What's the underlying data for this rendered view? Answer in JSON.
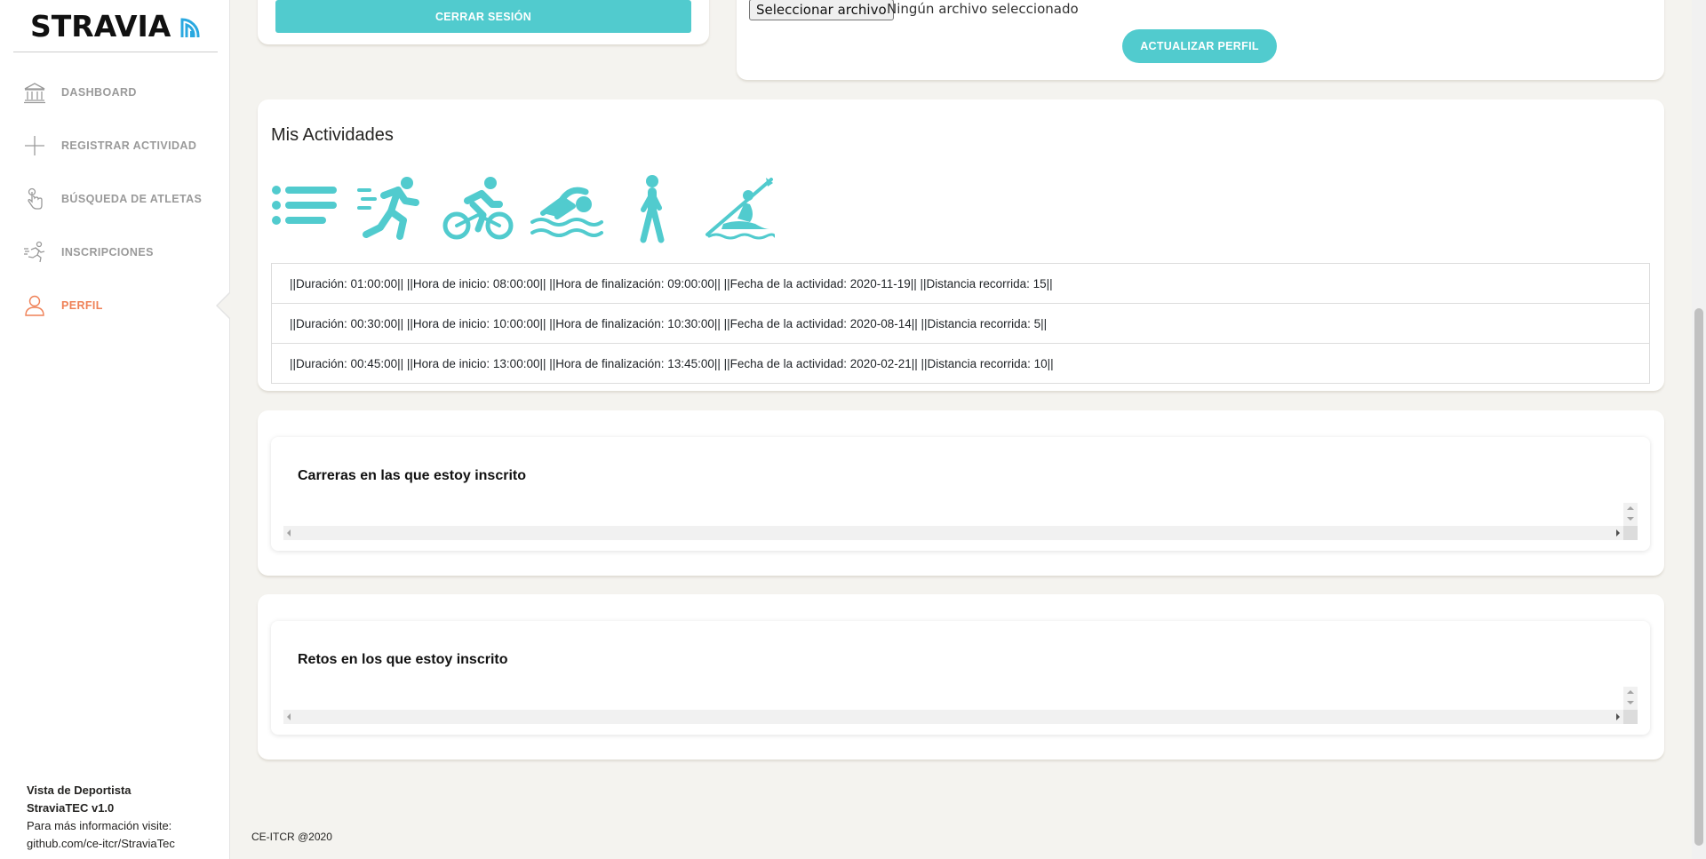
{
  "brand": {
    "name": "STRAVIA"
  },
  "sidebar": {
    "items": [
      {
        "label": "DASHBOARD",
        "icon": "bank-icon"
      },
      {
        "label": "REGISTRAR ACTIVIDAD",
        "icon": "plus-icon"
      },
      {
        "label": "BÚSQUEDA DE ATLETAS",
        "icon": "tap-icon"
      },
      {
        "label": "INSCRIPCIONES",
        "icon": "runner-icon"
      },
      {
        "label": "PERFIL",
        "icon": "user-icon",
        "active": true
      }
    ],
    "footer": {
      "line1": "Vista de Deportista",
      "line2": "StraviaTEC v1.0",
      "line3": "Para más información visite:",
      "line4": "github.com/ce-itcr/StraviaTec"
    }
  },
  "profile": {
    "logout_label": "CERRAR SESIÓN",
    "file_button_label": "Seleccionar archivo",
    "file_status": "Ningún archivo seleccionado",
    "update_label": "ACTUALIZAR PERFIL"
  },
  "activities": {
    "title": "Mis Actividades",
    "filters": [
      "list-icon",
      "running-icon",
      "cycling-icon",
      "swimming-icon",
      "walking-icon",
      "kayak-icon"
    ],
    "rows": [
      "||Duración: 01:00:00|| ||Hora de inicio: 08:00:00|| ||Hora de finalización: 09:00:00|| ||Fecha de la actividad: 2020-11-19|| ||Distancia recorrida: 15||",
      "||Duración: 00:30:00|| ||Hora de inicio: 10:00:00|| ||Hora de finalización: 10:30:00|| ||Fecha de la actividad: 2020-08-14|| ||Distancia recorrida: 5||",
      "||Duración: 00:45:00|| ||Hora de inicio: 13:00:00|| ||Hora de finalización: 13:45:00|| ||Fecha de la actividad: 2020-02-21|| ||Distancia recorrida: 10||"
    ]
  },
  "races": {
    "title": "Carreras en las que estoy inscrito"
  },
  "challenges": {
    "title": "Retos en los que estoy inscrito"
  },
  "footer": {
    "text": "CE-ITCR @2020"
  },
  "colors": {
    "accent": "#51cbce",
    "active": "#ef8157",
    "muted": "#9a9a9a"
  }
}
